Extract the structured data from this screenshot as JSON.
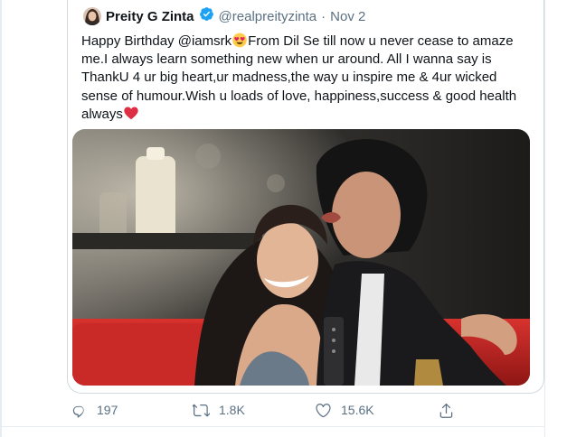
{
  "tweet": {
    "display_name": "Preity G Zinta",
    "handle": "@realpreityzinta",
    "separator": "·",
    "date": "Nov 2",
    "verified": true,
    "text_part1": "Happy Birthday @iamsrk",
    "emoji_1": "heart-eyes-emoji",
    "text_part2": "From Dil Se till now u never cease to amaze me.I always learn something new when ur around. All I wanna say is ThankU 4 ur big heart,ur madness,the way u inspire me & 4ur wicked sense of humour.Wish u loads of love, happiness,success & good health always",
    "emoji_2": "red-heart-emoji",
    "accent_color": "#1da1f2",
    "muted_color": "#5b7083"
  },
  "actions": {
    "reply": {
      "icon": "reply-icon",
      "count": "197"
    },
    "retweet": {
      "icon": "retweet-icon",
      "count": "1.8K"
    },
    "like": {
      "icon": "like-icon",
      "count": "15.6K"
    },
    "share": {
      "icon": "share-icon"
    }
  }
}
